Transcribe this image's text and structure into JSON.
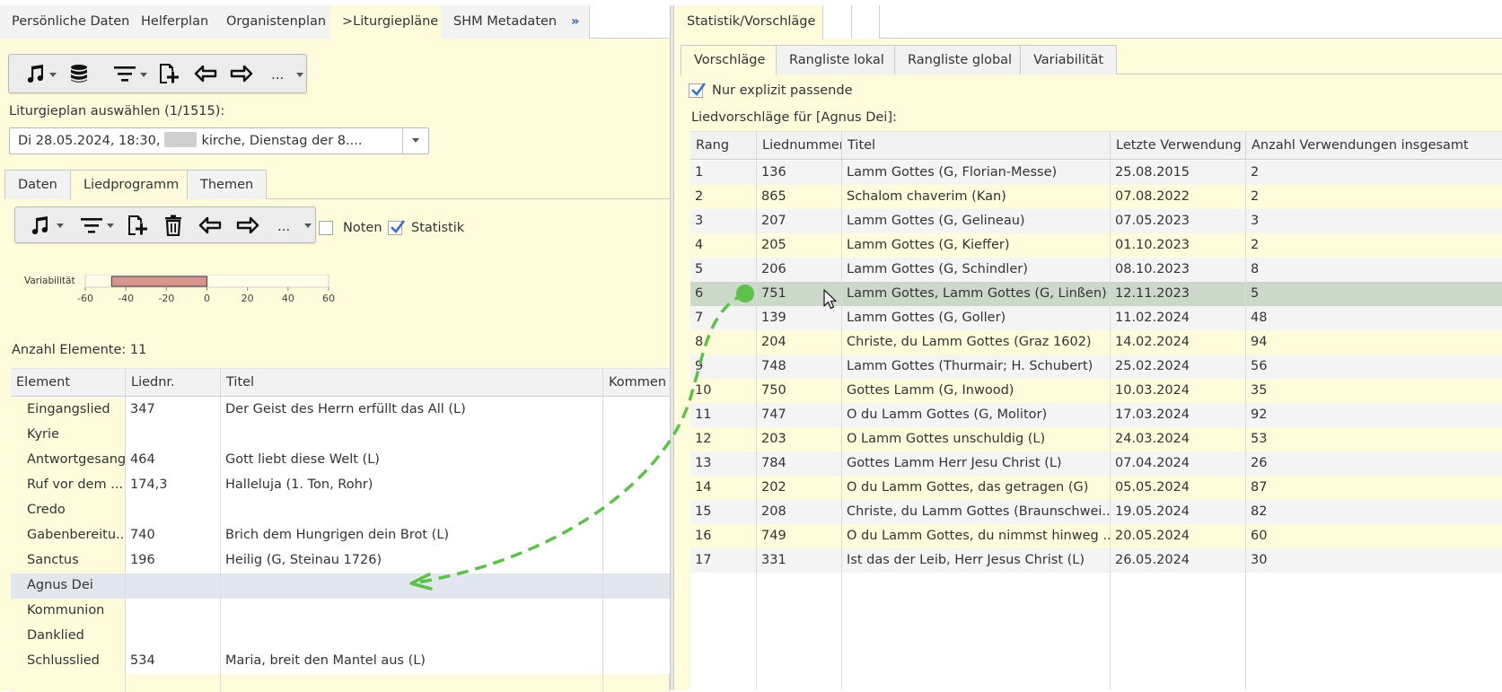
{
  "left": {
    "tabs": [
      {
        "label": "Persönliche Daten"
      },
      {
        "label": "Helferplan"
      },
      {
        "label": "Organistenplan"
      },
      {
        "label": ">Liturgiepläne"
      },
      {
        "label": "SHM Metadaten"
      },
      {
        "label": "»"
      }
    ],
    "toolbar1": {
      "more_label": "..."
    },
    "select_label": "Liturgieplan auswählen (1/1515):",
    "combo": {
      "text_before": "Di 28.05.2024, 18:30,",
      "text_after": "kirche, Dienstag der 8...."
    },
    "subtabs": [
      {
        "label": "Daten"
      },
      {
        "label": "Liedprogramm"
      },
      {
        "label": "Themen"
      }
    ],
    "toolbar2": {
      "more_label": "..."
    },
    "noten_label": "Noten",
    "statistik_label": "Statistik",
    "count_label": "Anzahl Elemente: 11",
    "grid": {
      "headers": [
        "Element",
        "Liednr.",
        "Titel",
        "Kommen"
      ],
      "rows": [
        {
          "element": "Eingangslied",
          "nr": "347",
          "titel": "Der Geist des Herrn erfüllt das All (L)"
        },
        {
          "element": "Kyrie",
          "nr": "",
          "titel": ""
        },
        {
          "element": "Antwortgesang",
          "nr": "464",
          "titel": "Gott liebt diese Welt (L)"
        },
        {
          "element": "Ruf vor dem ...",
          "nr": "174,3",
          "titel": "Halleluja (1. Ton, Rohr)"
        },
        {
          "element": "Credo",
          "nr": "",
          "titel": ""
        },
        {
          "element": "Gabenbereitu...",
          "nr": "740",
          "titel": "Brich dem Hungrigen dein Brot (L)"
        },
        {
          "element": "Sanctus",
          "nr": "196",
          "titel": "Heilig (G, Steinau 1726)"
        },
        {
          "element": "Agnus Dei",
          "nr": "",
          "titel": ""
        },
        {
          "element": "Kommunion",
          "nr": "",
          "titel": ""
        },
        {
          "element": "Danklied",
          "nr": "",
          "titel": ""
        },
        {
          "element": "Schlusslied",
          "nr": "534",
          "titel": "Maria, breit den Mantel aus (L)"
        }
      ]
    }
  },
  "chart_data": {
    "type": "bar",
    "ylabel": "Variabilität",
    "xlim": [
      -60,
      60
    ],
    "xticks": [
      "-60",
      "-40",
      "-20",
      "0",
      "20",
      "40",
      "60"
    ],
    "bar": {
      "from": -47,
      "to": 0
    },
    "color": "#d9958a"
  },
  "right": {
    "tabs": [
      {
        "label": "Statistik/Vorschläge"
      }
    ],
    "subtabs": [
      {
        "label": "Vorschläge"
      },
      {
        "label": "Rangliste lokal"
      },
      {
        "label": "Rangliste global"
      },
      {
        "label": "Variabilität"
      }
    ],
    "checkbox_label": "Nur explizit passende",
    "suggest_label": "Liedvorschläge für [Agnus Dei]:",
    "grid": {
      "headers": [
        "Rang",
        "Liednummer",
        "Titel",
        "Letzte Verwendung",
        "Anzahl Verwendungen insgesamt"
      ],
      "rows": [
        {
          "rang": "1",
          "nr": "136",
          "titel": "Lamm Gottes (G, Florian-Messe)",
          "letzte": "25.08.2015",
          "anzahl": "2"
        },
        {
          "rang": "2",
          "nr": "865",
          "titel": "Schalom chaverim (Kan)",
          "letzte": "07.08.2022",
          "anzahl": "2"
        },
        {
          "rang": "3",
          "nr": "207",
          "titel": "Lamm Gottes (G, Gelineau)",
          "letzte": "07.05.2023",
          "anzahl": "3"
        },
        {
          "rang": "4",
          "nr": "205",
          "titel": "Lamm Gottes (G, Kieffer)",
          "letzte": "01.10.2023",
          "anzahl": "2"
        },
        {
          "rang": "5",
          "nr": "206",
          "titel": "Lamm Gottes (G, Schindler)",
          "letzte": "08.10.2023",
          "anzahl": "8"
        },
        {
          "rang": "6",
          "nr": "751",
          "titel": "Lamm Gottes, Lamm Gottes (G, Linßen)",
          "letzte": "12.11.2023",
          "anzahl": "5"
        },
        {
          "rang": "7",
          "nr": "139",
          "titel": "Lamm Gottes (G, Goller)",
          "letzte": "11.02.2024",
          "anzahl": "48"
        },
        {
          "rang": "8",
          "nr": "204",
          "titel": "Christe, du Lamm Gottes (Graz 1602)",
          "letzte": "14.02.2024",
          "anzahl": "94"
        },
        {
          "rang": "9",
          "nr": "748",
          "titel": "Lamm Gottes (Thurmair; H. Schubert)",
          "letzte": "25.02.2024",
          "anzahl": "56"
        },
        {
          "rang": "10",
          "nr": "750",
          "titel": "Gottes Lamm (G, Inwood)",
          "letzte": "10.03.2024",
          "anzahl": "35"
        },
        {
          "rang": "11",
          "nr": "747",
          "titel": "O du Lamm Gottes (G, Molitor)",
          "letzte": "17.03.2024",
          "anzahl": "92"
        },
        {
          "rang": "12",
          "nr": "203",
          "titel": "O Lamm Gottes unschuldig (L)",
          "letzte": "24.03.2024",
          "anzahl": "53"
        },
        {
          "rang": "13",
          "nr": "784",
          "titel": "Gottes Lamm Herr Jesu Christ (L)",
          "letzte": "07.04.2024",
          "anzahl": "26"
        },
        {
          "rang": "14",
          "nr": "202",
          "titel": "O du Lamm Gottes, das getragen (G)",
          "letzte": "05.05.2024",
          "anzahl": "87"
        },
        {
          "rang": "15",
          "nr": "208",
          "titel": "Christe, du Lamm Gottes (Braunschwei...",
          "letzte": "19.05.2024",
          "anzahl": "82"
        },
        {
          "rang": "16",
          "nr": "749",
          "titel": "O du Lamm Gottes, du nimmst hinweg ...",
          "letzte": "20.05.2024",
          "anzahl": "60"
        },
        {
          "rang": "17",
          "nr": "331",
          "titel": "Ist das der Leib, Herr Jesus Christ (L)",
          "letzte": "26.05.2024",
          "anzahl": "30"
        }
      ]
    }
  },
  "icons": [
    "music-note-icon",
    "database-icon",
    "filter-icon",
    "add-document-icon",
    "trash-icon",
    "arrow-left-icon",
    "arrow-right-icon",
    "checkmark-icon",
    "mouse-cursor-icon",
    "drag-arrow-icon"
  ],
  "colors": {
    "panel_bg": "#fffbdb",
    "selected_row": "#cbd9c9",
    "highlight_row": "#e1e6ef",
    "drag_arrow": "#5cc24a",
    "checkbox_tick": "#3a6fd1"
  }
}
